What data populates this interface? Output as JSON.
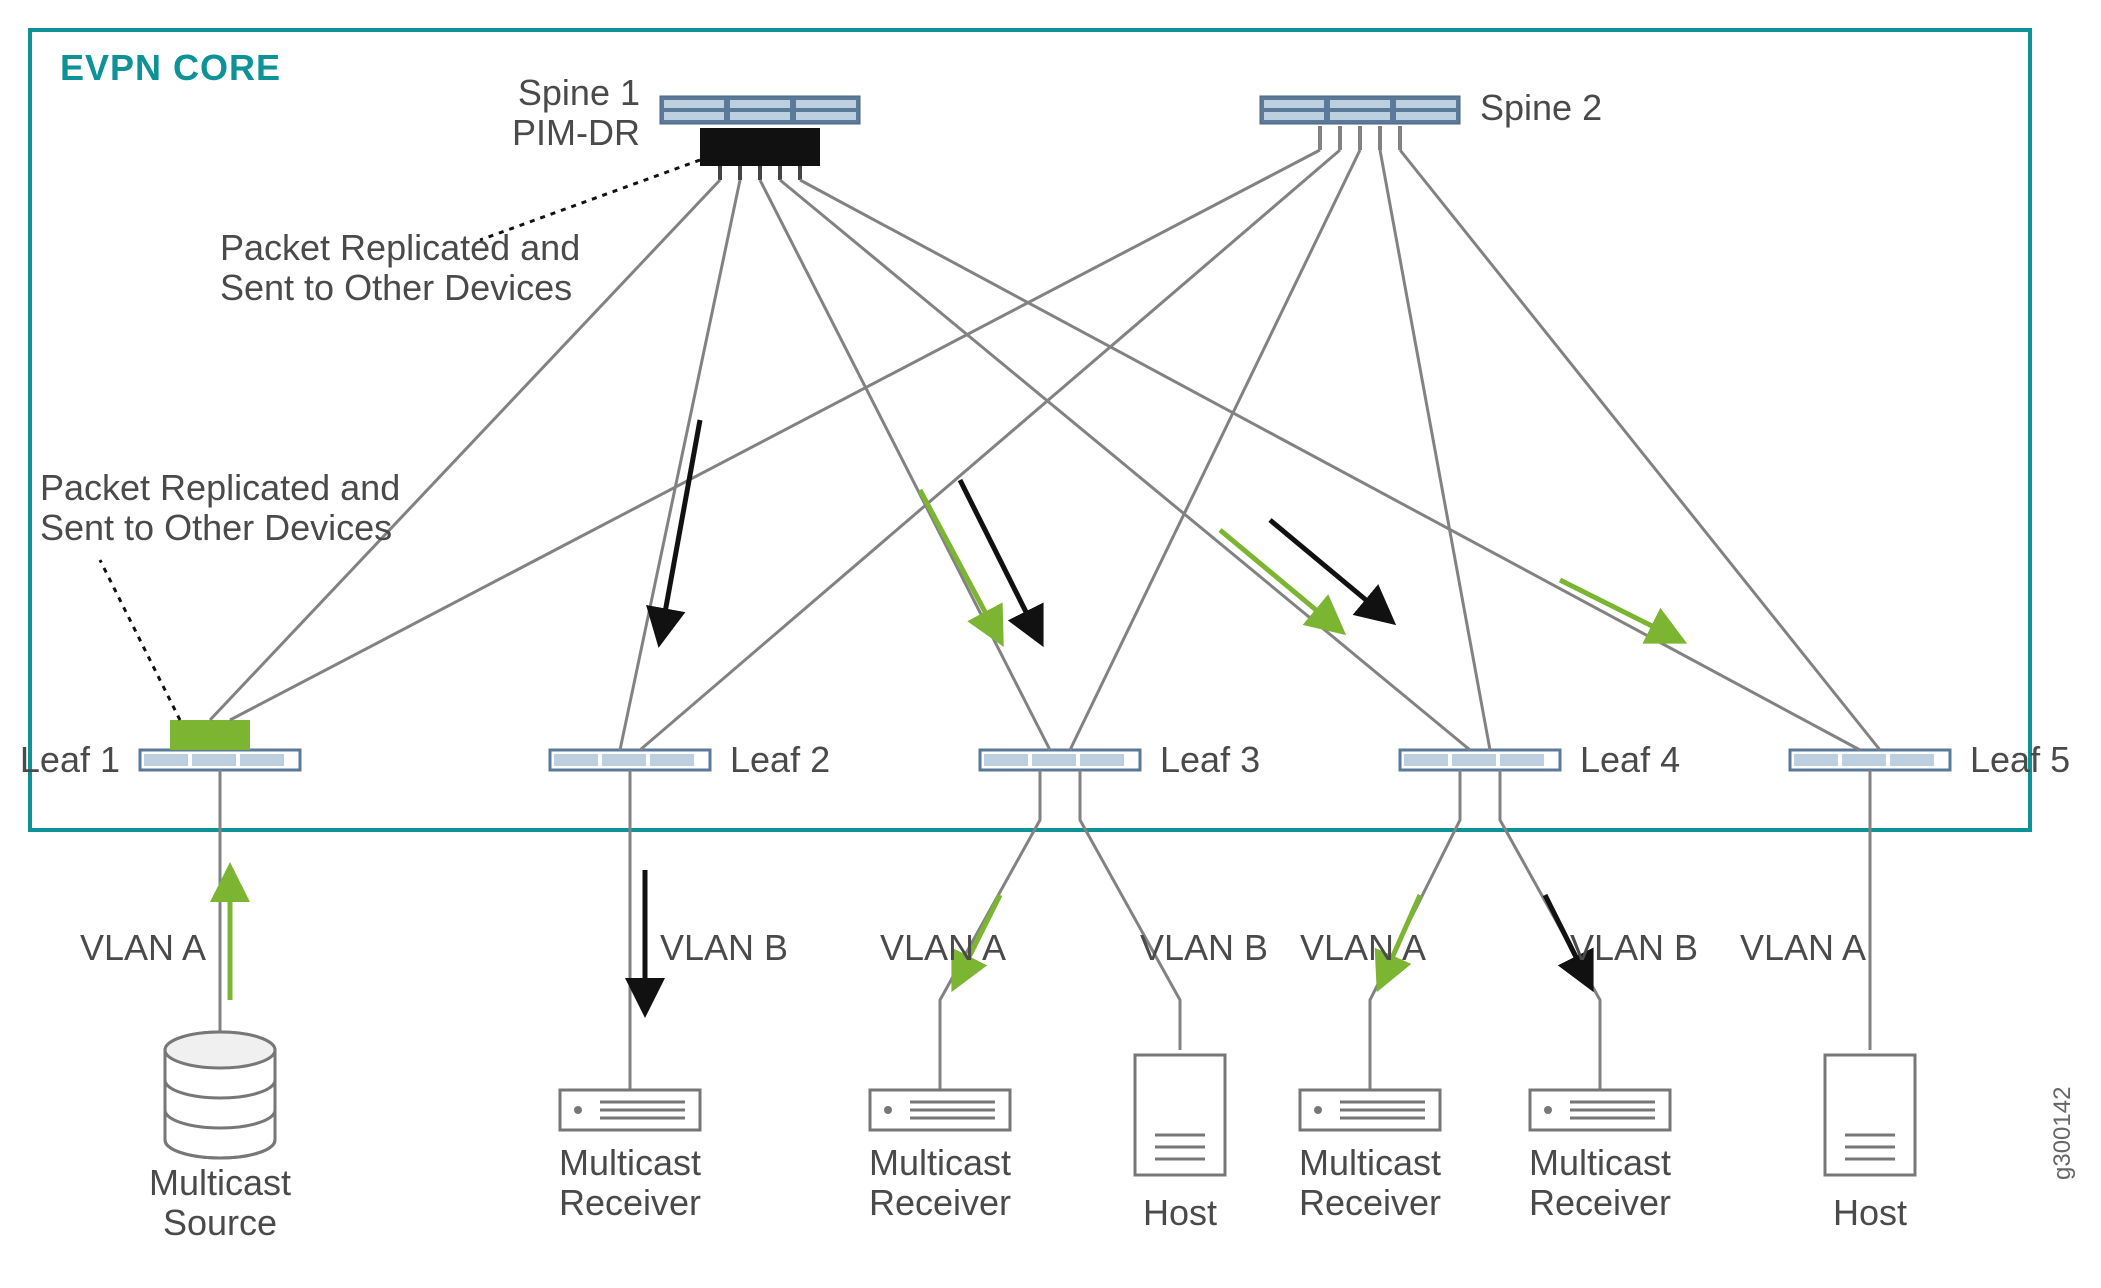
{
  "title": "EVPN CORE",
  "image_id": "g300142",
  "annotations": {
    "leaf1_replicate": "Packet Replicated and\nSent to Other Devices",
    "spine1_replicate": "Packet Replicated and\nSent to Other Devices"
  },
  "spines": [
    {
      "name": "Spine 1",
      "sub": "PIM-DR"
    },
    {
      "name": "Spine 2",
      "sub": ""
    }
  ],
  "leaves": [
    {
      "name": "Leaf 1"
    },
    {
      "name": "Leaf 2"
    },
    {
      "name": "Leaf 3"
    },
    {
      "name": "Leaf 4"
    },
    {
      "name": "Leaf 5"
    }
  ],
  "hosts": {
    "source": {
      "label": "Multicast\nSource",
      "vlan": "VLAN A"
    },
    "leaf2_rx": {
      "label": "Multicast\nReceiver",
      "vlan": "VLAN B"
    },
    "leaf3_rxA": {
      "label": "Multicast\nReceiver",
      "vlan": "VLAN A"
    },
    "leaf3_host": {
      "label": "Host",
      "vlan": "VLAN B"
    },
    "leaf4_rxA": {
      "label": "Multicast\nReceiver",
      "vlan": "VLAN A"
    },
    "leaf4_rxB": {
      "label": "Multicast\nReceiver",
      "vlan": "VLAN B"
    },
    "leaf5_host": {
      "label": "Host",
      "vlan": "VLAN A"
    }
  },
  "colors": {
    "border": "#0d9297",
    "line": "#828282",
    "green": "#7bb531",
    "black": "#111111",
    "switch_body": "#5b7a99",
    "switch_light": "#bcd0e0"
  }
}
